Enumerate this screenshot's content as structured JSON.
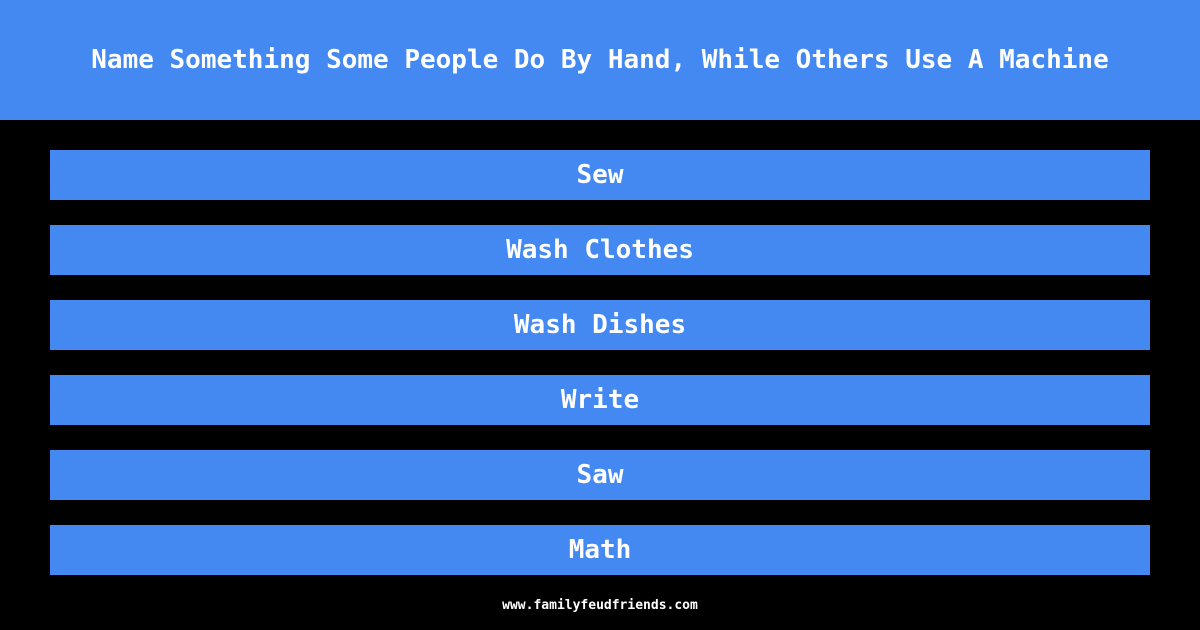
{
  "question": "Name Something Some People Do By Hand, While Others Use A Machine",
  "answers": [
    "Sew",
    "Wash Clothes",
    "Wash Dishes",
    "Write",
    "Saw",
    "Math"
  ],
  "footer": "www.familyfeudfriends.com",
  "colors": {
    "accent": "#4488f2",
    "background": "#000000",
    "text": "#ffffff"
  }
}
